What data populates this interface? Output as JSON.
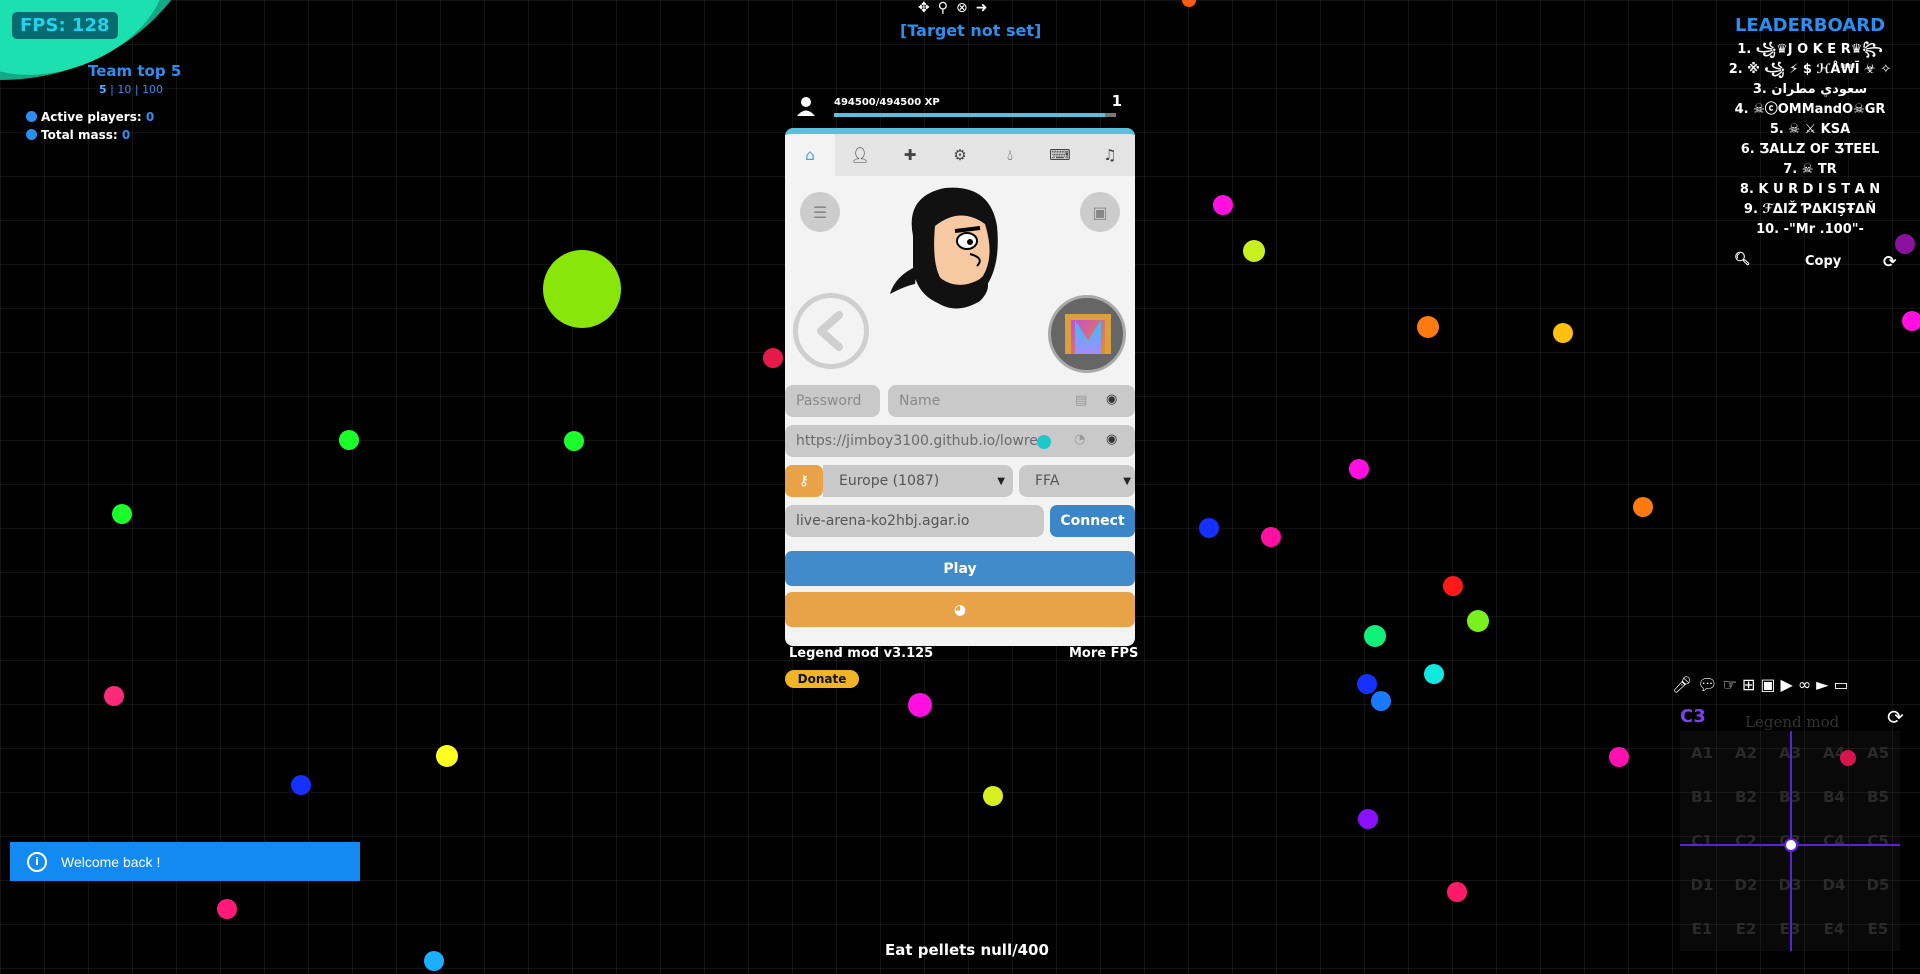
{
  "hud": {
    "fps": "FPS: 128",
    "team_title": "Team top 5",
    "team_sizes": [
      "5",
      "10",
      "100"
    ],
    "active_players_label": "Active players:",
    "active_players_value": "0",
    "total_mass_label": "Total mass:",
    "total_mass_value": "0",
    "target": "[Target not set]",
    "eat_pellets": "Eat pellets null/400"
  },
  "top_icons": [
    "crosshair-icon",
    "map-pin-icon",
    "cancel-circle-icon",
    "arrow-right-icon"
  ],
  "leaderboard": {
    "title": "LEADERBOARD",
    "entries": [
      "1. ꧁♛J O K E R♛꧂",
      "2. ※ ꧁ ⚡ $ ℋÅ₩Ī ☣ ✧",
      "3. سعودي مطران",
      "4. ☠ⓒOMMandO☠GR",
      "5. ☠ ⚔ KSA",
      "6. ƷALLZ OF ƷTEEL",
      "7. ☠ TR",
      "8. K U R D I S T A N",
      "9. ℱΔIŽ ƤΔKIŞŦΔŇ",
      "10. -\"Mr .100\"-"
    ],
    "copy_label": "Copy"
  },
  "profile": {
    "xp_text": "494500/494500 XP",
    "xp_fraction": 0.96,
    "level": "1"
  },
  "panel": {
    "tabs": [
      "home-icon",
      "user-icon",
      "puzzle-icon",
      "gear-icon",
      "drop-icon",
      "keyboard-icon",
      "music-icon"
    ],
    "password_placeholder": "Password",
    "name_placeholder": "Name",
    "skin_url": "https://jimboy3100.github.io/lowre",
    "region": "Europe (1087)",
    "mode": "FFA",
    "server": "live-arena-ko2hbj.agar.io",
    "connect_label": "Connect",
    "play_label": "Play",
    "version": "Legend mod v3.125",
    "more_fps": "More FPS",
    "donate": "Donate"
  },
  "notification": {
    "text": "Welcome back !"
  },
  "minimap": {
    "sector": "C3",
    "label": "Legend mod",
    "sectors": [
      [
        "A1",
        "A2",
        "A3",
        "A4",
        "A5"
      ],
      [
        "B1",
        "B2",
        "B3",
        "B4",
        "B5"
      ],
      [
        "C1",
        "C2",
        "C3",
        "C4",
        "C5"
      ],
      [
        "D1",
        "D2",
        "D3",
        "D4",
        "D5"
      ],
      [
        "E1",
        "E2",
        "E3",
        "E4",
        "E5"
      ]
    ],
    "icons": [
      "microphone-icon",
      "chat-icon",
      "pointer-icon",
      "sitemap-icon",
      "image-icon",
      "youtube-icon",
      "binoculars-icon",
      "play-icon",
      "monitor-icon"
    ]
  },
  "colors": {
    "accent_blue": "#2b8ff0",
    "panel_top": "#5bc0de",
    "play": "#428bca",
    "orange": "#e8a349",
    "connect": "#3a86c8",
    "notification": "#138af2",
    "sector_purple": "#7b3ff2"
  }
}
